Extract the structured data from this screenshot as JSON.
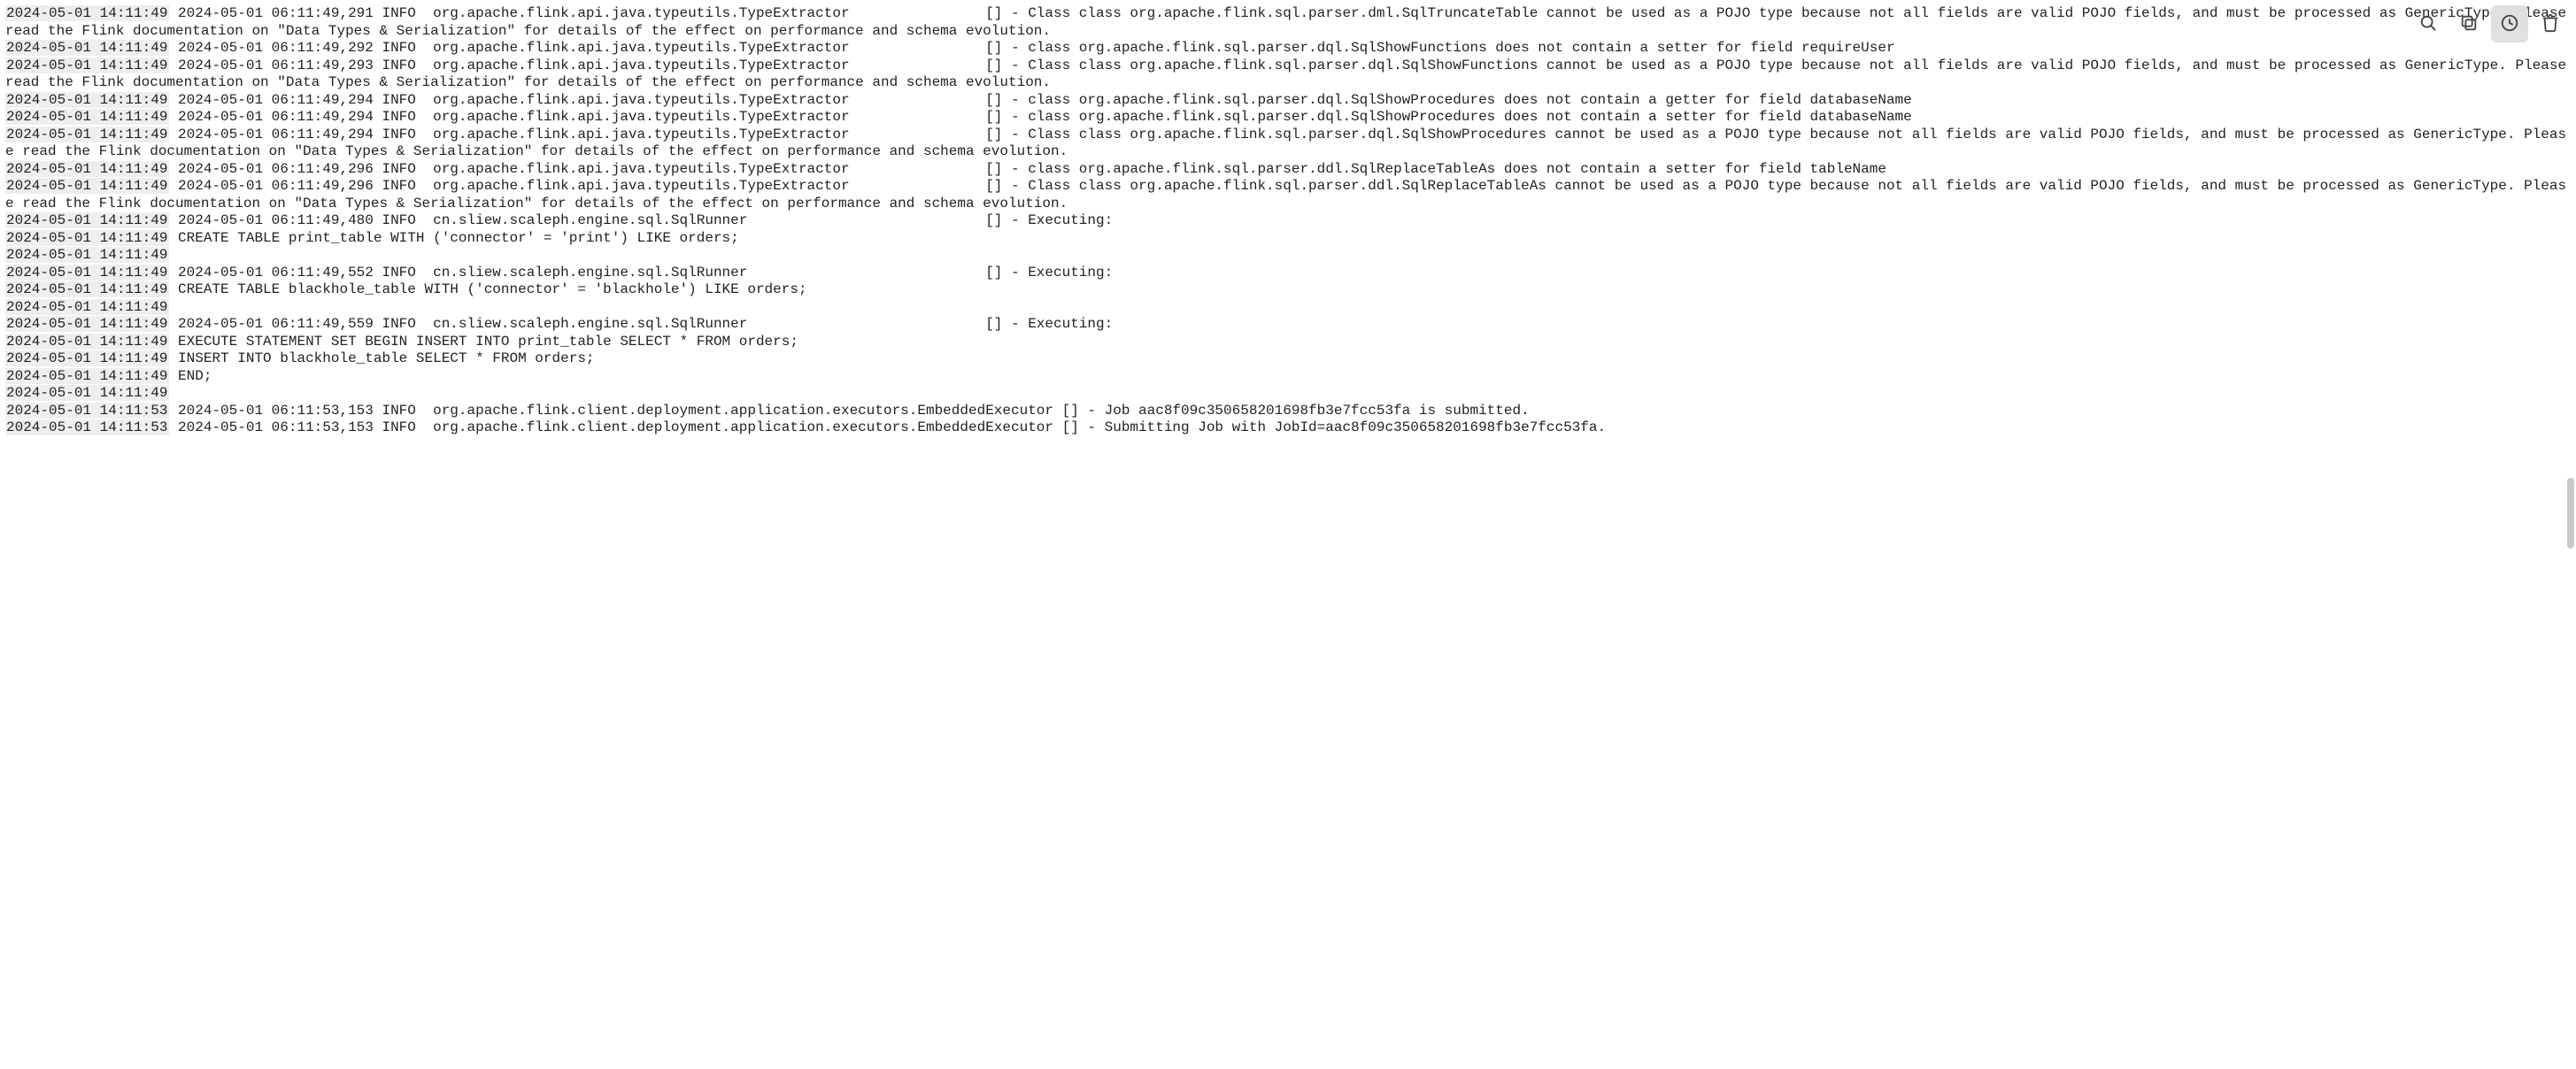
{
  "toolbar": {
    "search_icon": "search-icon",
    "copy_icon": "copy-icon",
    "clock_icon": "clock-icon",
    "trash_icon": "trash-icon"
  },
  "log": {
    "lines": [
      {
        "ts": "2024-05-01 14:11:49",
        "msg": " 2024-05-01 06:11:49,291 INFO  org.apache.flink.api.java.typeutils.TypeExtractor                [] - Class class org.apache.flink.sql.parser.dml.SqlTruncateTable cannot be used as a POJO type because not all fields are valid POJO fields, and must be processed as GenericType. Please read the Flink documentation on \"Data Types & Serialization\" for details of the effect on performance and schema evolution."
      },
      {
        "ts": "2024-05-01 14:11:49",
        "msg": " 2024-05-01 06:11:49,292 INFO  org.apache.flink.api.java.typeutils.TypeExtractor                [] - class org.apache.flink.sql.parser.dql.SqlShowFunctions does not contain a setter for field requireUser"
      },
      {
        "ts": "2024-05-01 14:11:49",
        "msg": " 2024-05-01 06:11:49,293 INFO  org.apache.flink.api.java.typeutils.TypeExtractor                [] - Class class org.apache.flink.sql.parser.dql.SqlShowFunctions cannot be used as a POJO type because not all fields are valid POJO fields, and must be processed as GenericType. Please read the Flink documentation on \"Data Types & Serialization\" for details of the effect on performance and schema evolution."
      },
      {
        "ts": "2024-05-01 14:11:49",
        "msg": " 2024-05-01 06:11:49,294 INFO  org.apache.flink.api.java.typeutils.TypeExtractor                [] - class org.apache.flink.sql.parser.dql.SqlShowProcedures does not contain a getter for field databaseName"
      },
      {
        "ts": "2024-05-01 14:11:49",
        "msg": " 2024-05-01 06:11:49,294 INFO  org.apache.flink.api.java.typeutils.TypeExtractor                [] - class org.apache.flink.sql.parser.dql.SqlShowProcedures does not contain a setter for field databaseName"
      },
      {
        "ts": "2024-05-01 14:11:49",
        "msg": " 2024-05-01 06:11:49,294 INFO  org.apache.flink.api.java.typeutils.TypeExtractor                [] - Class class org.apache.flink.sql.parser.dql.SqlShowProcedures cannot be used as a POJO type because not all fields are valid POJO fields, and must be processed as GenericType. Please read the Flink documentation on \"Data Types & Serialization\" for details of the effect on performance and schema evolution."
      },
      {
        "ts": "2024-05-01 14:11:49",
        "msg": " 2024-05-01 06:11:49,296 INFO  org.apache.flink.api.java.typeutils.TypeExtractor                [] - class org.apache.flink.sql.parser.ddl.SqlReplaceTableAs does not contain a setter for field tableName"
      },
      {
        "ts": "2024-05-01 14:11:49",
        "msg": " 2024-05-01 06:11:49,296 INFO  org.apache.flink.api.java.typeutils.TypeExtractor                [] - Class class org.apache.flink.sql.parser.ddl.SqlReplaceTableAs cannot be used as a POJO type because not all fields are valid POJO fields, and must be processed as GenericType. Please read the Flink documentation on \"Data Types & Serialization\" for details of the effect on performance and schema evolution."
      },
      {
        "ts": "2024-05-01 14:11:49",
        "msg": " 2024-05-01 06:11:49,480 INFO  cn.sliew.scaleph.engine.sql.SqlRunner                            [] - Executing:"
      },
      {
        "ts": "2024-05-01 14:11:49",
        "msg": " CREATE TABLE print_table WITH ('connector' = 'print') LIKE orders;"
      },
      {
        "ts": "2024-05-01 14:11:49",
        "msg": ""
      },
      {
        "ts": "2024-05-01 14:11:49",
        "msg": " 2024-05-01 06:11:49,552 INFO  cn.sliew.scaleph.engine.sql.SqlRunner                            [] - Executing:"
      },
      {
        "ts": "2024-05-01 14:11:49",
        "msg": " CREATE TABLE blackhole_table WITH ('connector' = 'blackhole') LIKE orders;"
      },
      {
        "ts": "2024-05-01 14:11:49",
        "msg": ""
      },
      {
        "ts": "2024-05-01 14:11:49",
        "msg": " 2024-05-01 06:11:49,559 INFO  cn.sliew.scaleph.engine.sql.SqlRunner                            [] - Executing:"
      },
      {
        "ts": "2024-05-01 14:11:49",
        "msg": " EXECUTE STATEMENT SET BEGIN INSERT INTO print_table SELECT * FROM orders;"
      },
      {
        "ts": "2024-05-01 14:11:49",
        "msg": " INSERT INTO blackhole_table SELECT * FROM orders;"
      },
      {
        "ts": "2024-05-01 14:11:49",
        "msg": " END;"
      },
      {
        "ts": "2024-05-01 14:11:49",
        "msg": ""
      },
      {
        "ts": "2024-05-01 14:11:53",
        "msg": " 2024-05-01 06:11:53,153 INFO  org.apache.flink.client.deployment.application.executors.EmbeddedExecutor [] - Job aac8f09c350658201698fb3e7fcc53fa is submitted."
      },
      {
        "ts": "2024-05-01 14:11:53",
        "msg": " 2024-05-01 06:11:53,153 INFO  org.apache.flink.client.deployment.application.executors.EmbeddedExecutor [] - Submitting Job with JobId=aac8f09c350658201698fb3e7fcc53fa."
      }
    ]
  }
}
